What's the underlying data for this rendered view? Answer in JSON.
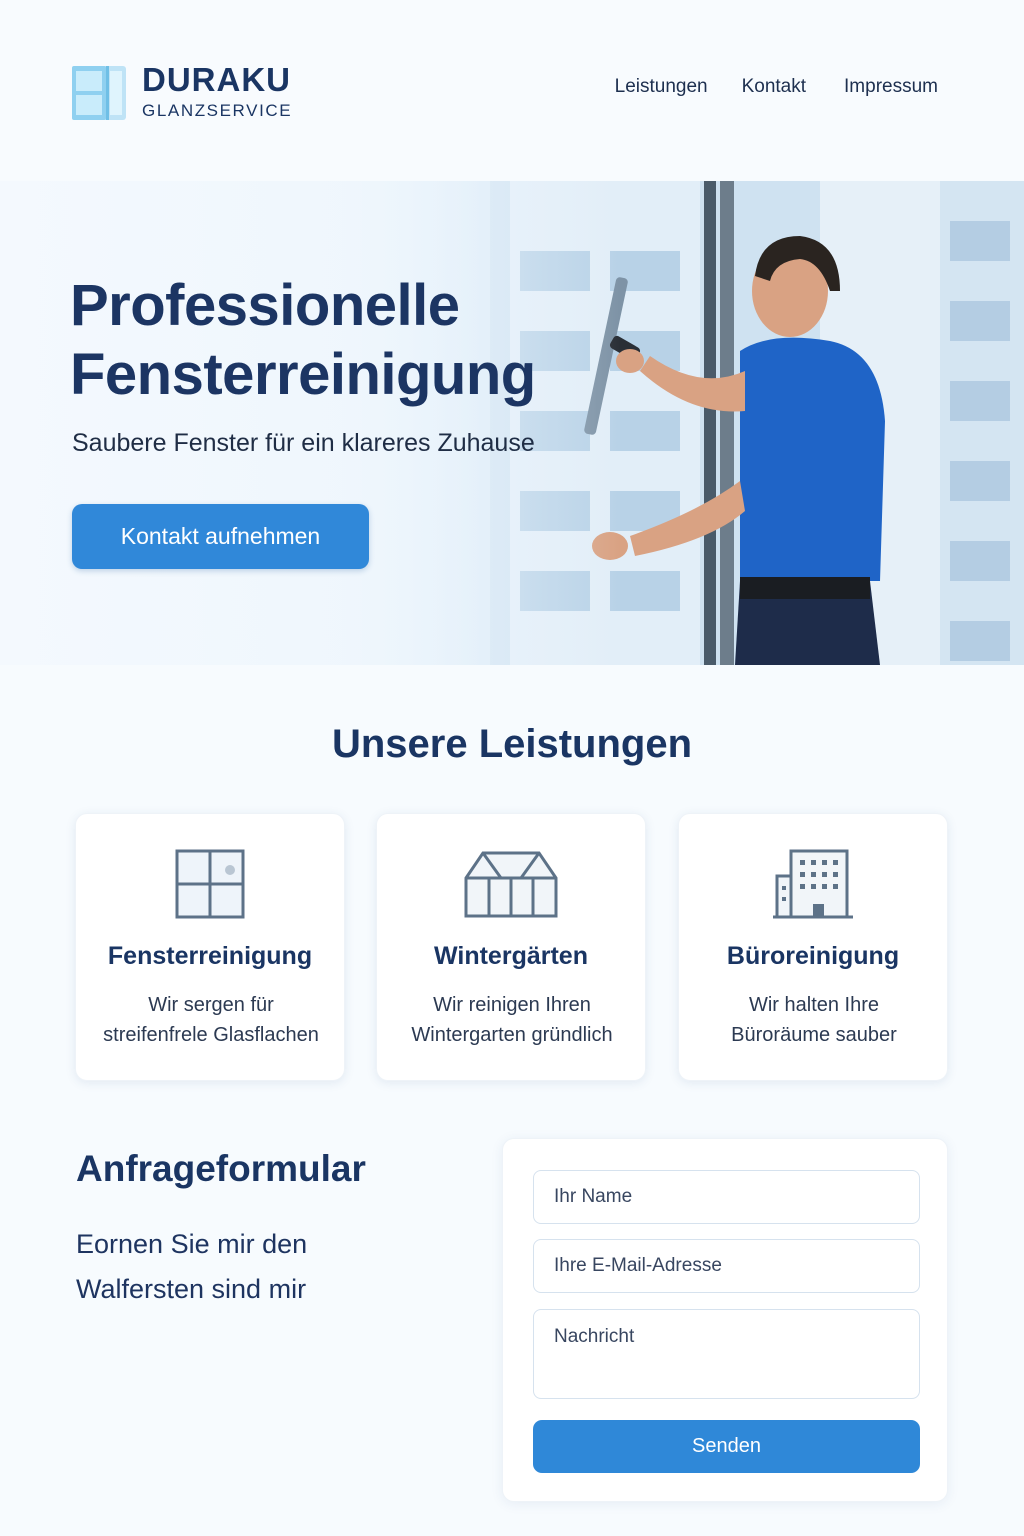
{
  "brand": {
    "name": "DURAKU",
    "tagline": "GLANZSERVICE"
  },
  "nav": {
    "items": [
      "Leistungen",
      "Kontakt",
      "Impressum"
    ]
  },
  "hero": {
    "title_line1": "Professionelle",
    "title_line2": "Fensterreinigung",
    "subtitle": "Saubere Fenster für ein klareres Zuhause",
    "cta": "Kontakt aufnehmen"
  },
  "services": {
    "title": "Unsere Leistungen",
    "cards": [
      {
        "icon": "window-icon",
        "title": "Fensterreinigung",
        "line1": "Wir sergen für",
        "line2": "streifenfrele Glasflachen"
      },
      {
        "icon": "greenhouse-icon",
        "title": "Wintergärten",
        "line1": "Wir reinigen Ihren",
        "line2": "Wintergarten gründlich"
      },
      {
        "icon": "office-building-icon",
        "title": "Büroreinigung",
        "line1": "Wir halten Ihre",
        "line2": "Büroräume sauber"
      }
    ]
  },
  "form_section": {
    "title": "Anfrageformular",
    "copy_line1": "Eornen Sie mir den",
    "copy_line2": "Walfersten sind mir",
    "name_placeholder": "Ihr Name",
    "email_placeholder": "Ihre E-Mail-Adresse",
    "message_placeholder": "Nachricht",
    "submit": "Senden"
  },
  "colors": {
    "primary": "#3088d9",
    "heading": "#1a3563"
  }
}
